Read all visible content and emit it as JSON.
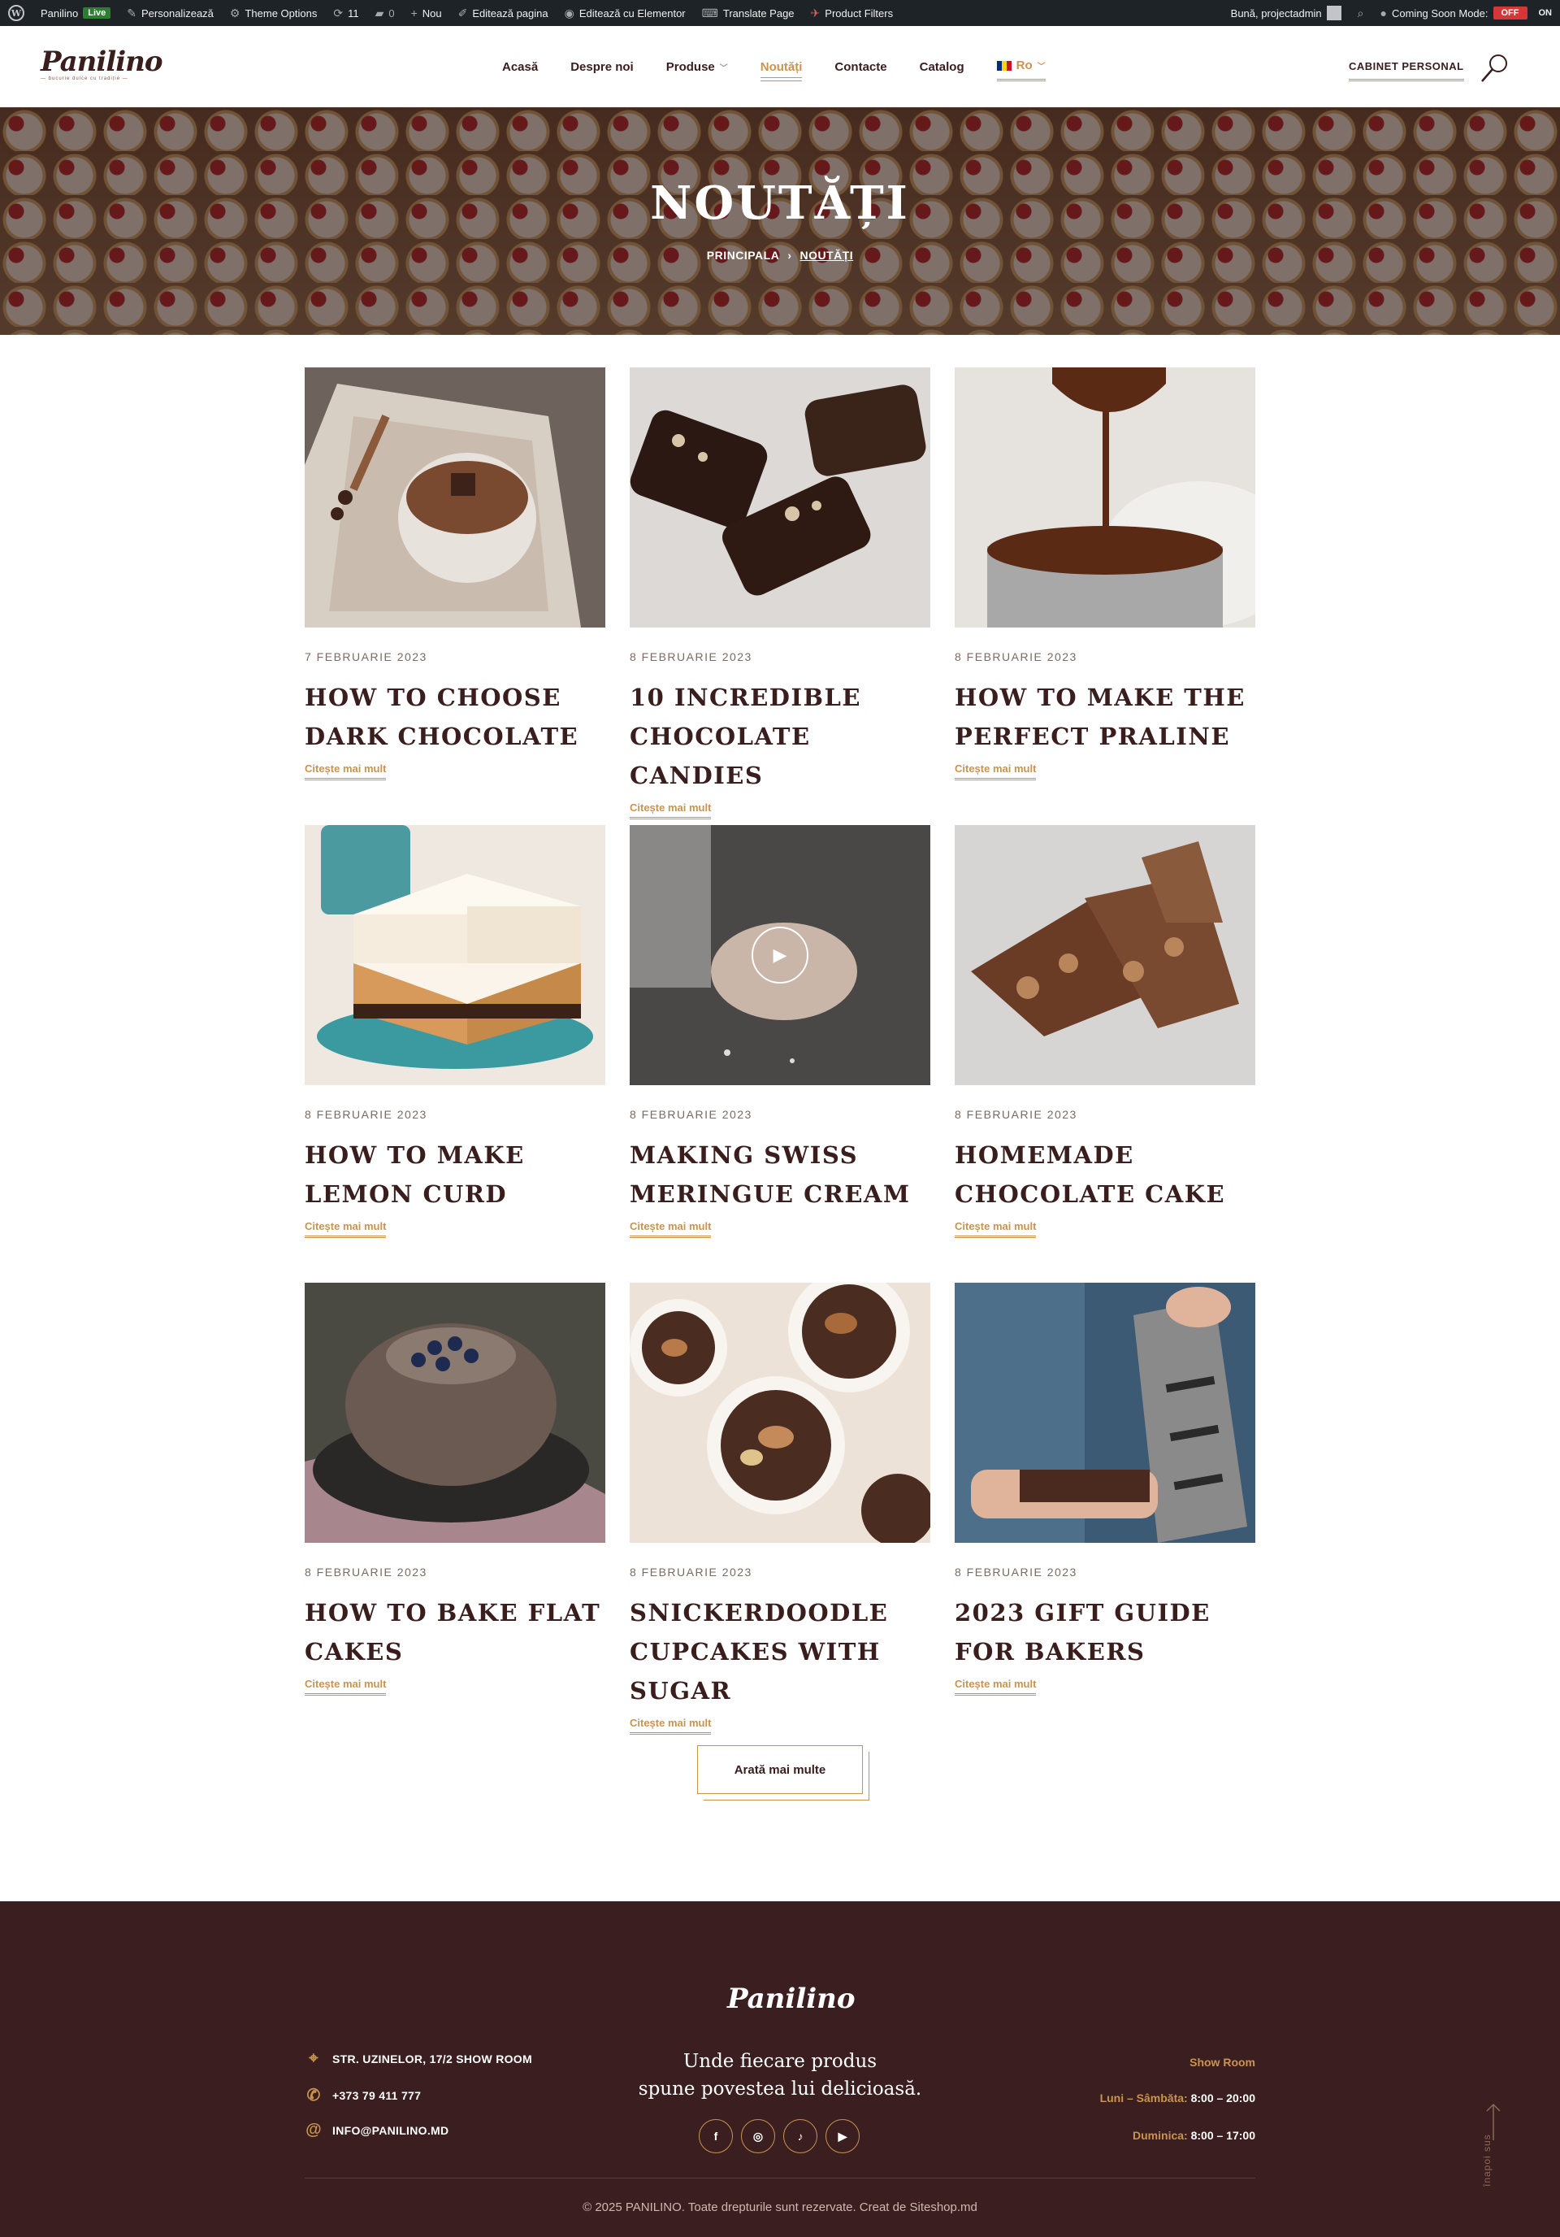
{
  "admin_bar": {
    "wp_logo": "W",
    "site_name": "Panilino",
    "live": "Live",
    "customize": "Personalizează",
    "theme_options": "Theme Options",
    "updates_count": "11",
    "comments_count": "0",
    "new": "Nou",
    "edit_page": "Editează pagina",
    "edit_elementor": "Editează cu Elementor",
    "translate": "Translate Page",
    "product_filters": "Product Filters",
    "greeting": "Bună, projectadmin",
    "coming_soon": "Coming Soon Mode:",
    "off": "OFF",
    "on": "ON"
  },
  "header": {
    "logo": "Panilino",
    "logo_sub": "— bucurie dulce cu tradiție —",
    "nav": [
      "Acasă",
      "Despre noi",
      "Produse",
      "Noutăți",
      "Contacte",
      "Catalog"
    ],
    "lang": "Ro",
    "cabinet": "CABINET PERSONAL"
  },
  "hero": {
    "title": "NOUTĂȚI",
    "crumb_home": "PRINCIPALA",
    "crumb_sep": "›",
    "crumb_current": "NOUTĂȚI"
  },
  "posts": [
    {
      "date": "7 FEBRUARIE 2023",
      "title": "HOW TO CHOOSE DARK CHOCOLATE",
      "more": "Citește mai mult"
    },
    {
      "date": "8 FEBRUARIE 2023",
      "title": "10 INCREDIBLE CHOCOLATE CANDIES",
      "more": "Citește mai mult"
    },
    {
      "date": "8 FEBRUARIE 2023",
      "title": "HOW TO MAKE THE PERFECT PRALINE",
      "more": "Citește mai mult"
    },
    {
      "date": "8 FEBRUARIE 2023",
      "title": "HOW TO MAKE LEMON CURD",
      "more": "Citește mai mult"
    },
    {
      "date": "8 FEBRUARIE 2023",
      "title": "MAKING SWISS MERINGUE CREAM",
      "more": "Citește mai mult"
    },
    {
      "date": "8 FEBRUARIE 2023",
      "title": "HOMEMADE CHOCOLATE CAKE",
      "more": "Citește mai mult"
    },
    {
      "date": "8 FEBRUARIE 2023",
      "title": "HOW TO BAKE FLAT CAKES",
      "more": "Citește mai mult"
    },
    {
      "date": "8 FEBRUARIE 2023",
      "title": "SNICKERDOODLE CUPCAKES WITH SUGAR",
      "more": "Citește mai mult"
    },
    {
      "date": "8 FEBRUARIE 2023",
      "title": "2023 GIFT GUIDE FOR BAKERS",
      "more": "Citește mai mult"
    }
  ],
  "load_more": "Arată mai multe",
  "footer": {
    "logo": "Panilino",
    "tagline_1": "Unde fiecare produs",
    "tagline_2": "spune povestea lui delicioasă.",
    "address": "STR. UZINELOR, 17/2 SHOW ROOM",
    "phone": "+373 79 411 777",
    "email": "INFO@PANILINO.MD",
    "showroom": "Show Room",
    "hours_week_label": "Luni – Sâmbăta:",
    "hours_week": "8:00 – 20:00",
    "hours_sun_label": "Duminica:",
    "hours_sun": "8:00 – 17:00",
    "socials": [
      "f",
      "◎",
      "♪",
      "▶"
    ],
    "copyright": "© 2025 PANILINO. Toate drepturile sunt rezervate. Creat de Siteshop.md",
    "back_to_top": "înapoi sus"
  },
  "colors": {
    "accent": "#c8944e",
    "brand_dark": "#3b1e1f",
    "admin_bar": "#1d2327"
  },
  "icons": [
    "wordpress-icon",
    "brush-icon",
    "gear-icon",
    "refresh-icon",
    "comment-icon",
    "plus-icon",
    "pencil-icon",
    "elementor-icon",
    "translate-icon",
    "filter-icon",
    "search-icon",
    "location-icon",
    "phone-icon",
    "at-icon",
    "arrow-up-icon",
    "play-icon"
  ]
}
